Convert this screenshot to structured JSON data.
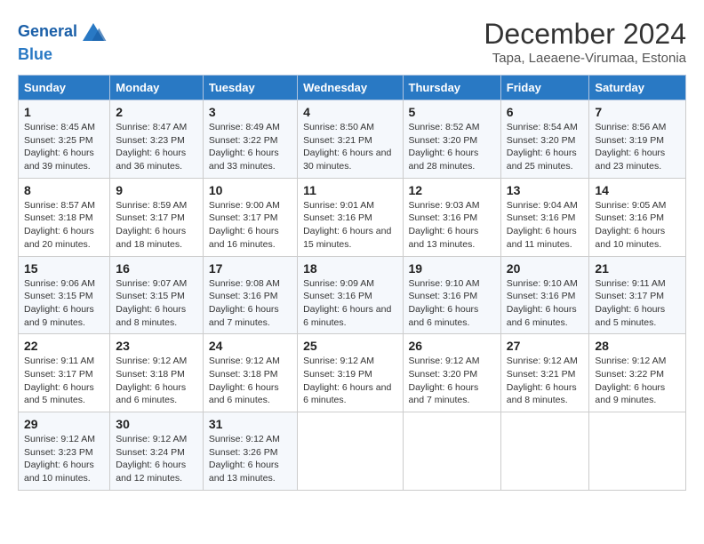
{
  "header": {
    "logo_line1": "General",
    "logo_line2": "Blue",
    "main_title": "December 2024",
    "subtitle": "Tapa, Laeaene-Virumaa, Estonia"
  },
  "days_header": [
    "Sunday",
    "Monday",
    "Tuesday",
    "Wednesday",
    "Thursday",
    "Friday",
    "Saturday"
  ],
  "weeks": [
    [
      {
        "day": "1",
        "sunrise": "8:45 AM",
        "sunset": "3:25 PM",
        "daylight": "6 hours and 39 minutes."
      },
      {
        "day": "2",
        "sunrise": "8:47 AM",
        "sunset": "3:23 PM",
        "daylight": "6 hours and 36 minutes."
      },
      {
        "day": "3",
        "sunrise": "8:49 AM",
        "sunset": "3:22 PM",
        "daylight": "6 hours and 33 minutes."
      },
      {
        "day": "4",
        "sunrise": "8:50 AM",
        "sunset": "3:21 PM",
        "daylight": "6 hours and 30 minutes."
      },
      {
        "day": "5",
        "sunrise": "8:52 AM",
        "sunset": "3:20 PM",
        "daylight": "6 hours and 28 minutes."
      },
      {
        "day": "6",
        "sunrise": "8:54 AM",
        "sunset": "3:20 PM",
        "daylight": "6 hours and 25 minutes."
      },
      {
        "day": "7",
        "sunrise": "8:56 AM",
        "sunset": "3:19 PM",
        "daylight": "6 hours and 23 minutes."
      }
    ],
    [
      {
        "day": "8",
        "sunrise": "8:57 AM",
        "sunset": "3:18 PM",
        "daylight": "6 hours and 20 minutes."
      },
      {
        "day": "9",
        "sunrise": "8:59 AM",
        "sunset": "3:17 PM",
        "daylight": "6 hours and 18 minutes."
      },
      {
        "day": "10",
        "sunrise": "9:00 AM",
        "sunset": "3:17 PM",
        "daylight": "6 hours and 16 minutes."
      },
      {
        "day": "11",
        "sunrise": "9:01 AM",
        "sunset": "3:16 PM",
        "daylight": "6 hours and 15 minutes."
      },
      {
        "day": "12",
        "sunrise": "9:03 AM",
        "sunset": "3:16 PM",
        "daylight": "6 hours and 13 minutes."
      },
      {
        "day": "13",
        "sunrise": "9:04 AM",
        "sunset": "3:16 PM",
        "daylight": "6 hours and 11 minutes."
      },
      {
        "day": "14",
        "sunrise": "9:05 AM",
        "sunset": "3:16 PM",
        "daylight": "6 hours and 10 minutes."
      }
    ],
    [
      {
        "day": "15",
        "sunrise": "9:06 AM",
        "sunset": "3:15 PM",
        "daylight": "6 hours and 9 minutes."
      },
      {
        "day": "16",
        "sunrise": "9:07 AM",
        "sunset": "3:15 PM",
        "daylight": "6 hours and 8 minutes."
      },
      {
        "day": "17",
        "sunrise": "9:08 AM",
        "sunset": "3:16 PM",
        "daylight": "6 hours and 7 minutes."
      },
      {
        "day": "18",
        "sunrise": "9:09 AM",
        "sunset": "3:16 PM",
        "daylight": "6 hours and 6 minutes."
      },
      {
        "day": "19",
        "sunrise": "9:10 AM",
        "sunset": "3:16 PM",
        "daylight": "6 hours and 6 minutes."
      },
      {
        "day": "20",
        "sunrise": "9:10 AM",
        "sunset": "3:16 PM",
        "daylight": "6 hours and 6 minutes."
      },
      {
        "day": "21",
        "sunrise": "9:11 AM",
        "sunset": "3:17 PM",
        "daylight": "6 hours and 5 minutes."
      }
    ],
    [
      {
        "day": "22",
        "sunrise": "9:11 AM",
        "sunset": "3:17 PM",
        "daylight": "6 hours and 5 minutes."
      },
      {
        "day": "23",
        "sunrise": "9:12 AM",
        "sunset": "3:18 PM",
        "daylight": "6 hours and 6 minutes."
      },
      {
        "day": "24",
        "sunrise": "9:12 AM",
        "sunset": "3:18 PM",
        "daylight": "6 hours and 6 minutes."
      },
      {
        "day": "25",
        "sunrise": "9:12 AM",
        "sunset": "3:19 PM",
        "daylight": "6 hours and 6 minutes."
      },
      {
        "day": "26",
        "sunrise": "9:12 AM",
        "sunset": "3:20 PM",
        "daylight": "6 hours and 7 minutes."
      },
      {
        "day": "27",
        "sunrise": "9:12 AM",
        "sunset": "3:21 PM",
        "daylight": "6 hours and 8 minutes."
      },
      {
        "day": "28",
        "sunrise": "9:12 AM",
        "sunset": "3:22 PM",
        "daylight": "6 hours and 9 minutes."
      }
    ],
    [
      {
        "day": "29",
        "sunrise": "9:12 AM",
        "sunset": "3:23 PM",
        "daylight": "6 hours and 10 minutes."
      },
      {
        "day": "30",
        "sunrise": "9:12 AM",
        "sunset": "3:24 PM",
        "daylight": "6 hours and 12 minutes."
      },
      {
        "day": "31",
        "sunrise": "9:12 AM",
        "sunset": "3:26 PM",
        "daylight": "6 hours and 13 minutes."
      },
      null,
      null,
      null,
      null
    ]
  ],
  "labels": {
    "sunrise": "Sunrise:",
    "sunset": "Sunset:",
    "daylight": "Daylight:"
  }
}
